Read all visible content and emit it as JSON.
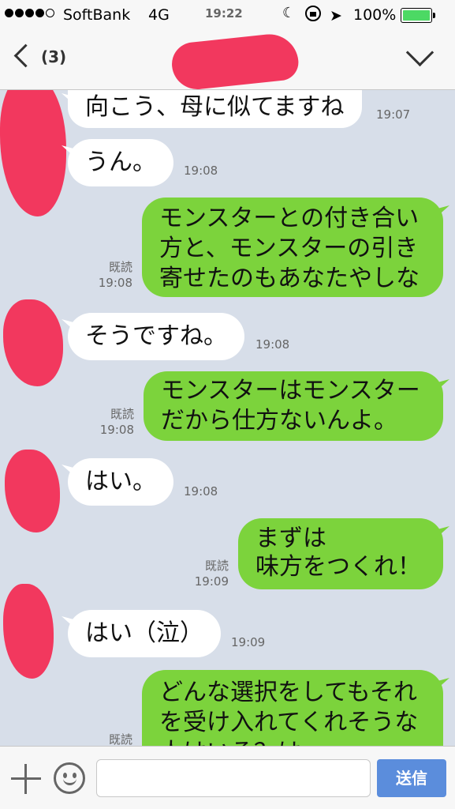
{
  "status_bar": {
    "carrier": "SoftBank",
    "network": "4G",
    "time": "19:22",
    "battery": "100%",
    "icons": [
      "signal-icon",
      "moon-icon",
      "rotation-lock-icon",
      "location-icon",
      "battery-icon"
    ]
  },
  "header": {
    "member_count": "(3)",
    "icons": [
      "back-icon",
      "chevron-down-icon"
    ]
  },
  "messages": [
    {
      "dir": "in",
      "text": "向こう、母に似てますね",
      "time": "19:07"
    },
    {
      "dir": "in",
      "text": "うん。",
      "time": "19:08"
    },
    {
      "dir": "out",
      "lines": [
        "モンスターとの付き合い",
        "方と、モンスターの引き",
        "寄せたのもあなたやしな"
      ],
      "read": "既読",
      "time": "19:08"
    },
    {
      "dir": "in",
      "text": "そうですね。",
      "time": "19:08"
    },
    {
      "dir": "out",
      "lines": [
        "モンスターはモンスター",
        "だから仕方ないんよ。"
      ],
      "read": "既読",
      "time": "19:08"
    },
    {
      "dir": "in",
      "text": "はい。",
      "time": "19:08"
    },
    {
      "dir": "out",
      "lines": [
        "まずは",
        "味方をつくれ！"
      ],
      "read": "既読",
      "time": "19:09"
    },
    {
      "dir": "in",
      "text": "はい（泣）",
      "time": "19:09"
    },
    {
      "dir": "out",
      "lines": [
        "どんな選択をしてもそれ",
        "を受け入れてくれそうな",
        "人はいる？は"
      ],
      "read": "既読",
      "time": ""
    }
  ],
  "input": {
    "placeholder": "",
    "send_label": "送信",
    "icons": [
      "plus-icon",
      "smiley-icon"
    ]
  },
  "colors": {
    "chat_bg": "#d7dee9",
    "outgoing_bubble": "#7cd33c",
    "incoming_bubble": "#ffffff",
    "send_button": "#5b8ddc",
    "redaction": "#f2385e"
  }
}
